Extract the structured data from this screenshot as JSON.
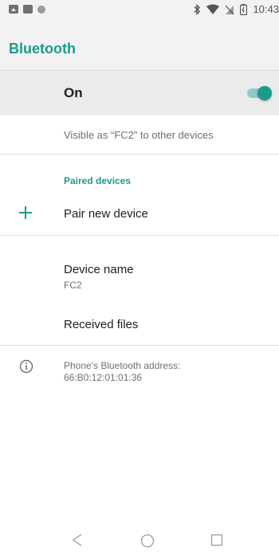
{
  "status_bar": {
    "time": "10:43",
    "left_icons": [
      "photo-notification-icon",
      "square-notification-icon",
      "circle-notification-icon"
    ],
    "right_icons": [
      "bluetooth-icon",
      "wifi-icon",
      "no-sim-icon",
      "battery-icon"
    ]
  },
  "app_bar": {
    "title": "Bluetooth"
  },
  "bluetooth_toggle": {
    "label": "On",
    "state": "on"
  },
  "visibility_text": "Visible as “FC2” to other devices",
  "paired_devices": {
    "header": "Paired devices",
    "pair_new_label": "Pair new device"
  },
  "device_name": {
    "title": "Device name",
    "value": "FC2"
  },
  "received_files": {
    "label": "Received files"
  },
  "address_info": {
    "line1": "Phone's Bluetooth address:",
    "line2": "66:B0:12:01:01:36"
  },
  "nav_bar": {
    "buttons": [
      "back-icon",
      "home-icon",
      "recents-icon"
    ]
  },
  "colors": {
    "accent": "#1a9b8e",
    "accent_light": "#8fcbc4",
    "bar_background": "#f2f2f2",
    "highlight_row": "#ebebeb",
    "secondary_text": "#6f6f6f"
  }
}
